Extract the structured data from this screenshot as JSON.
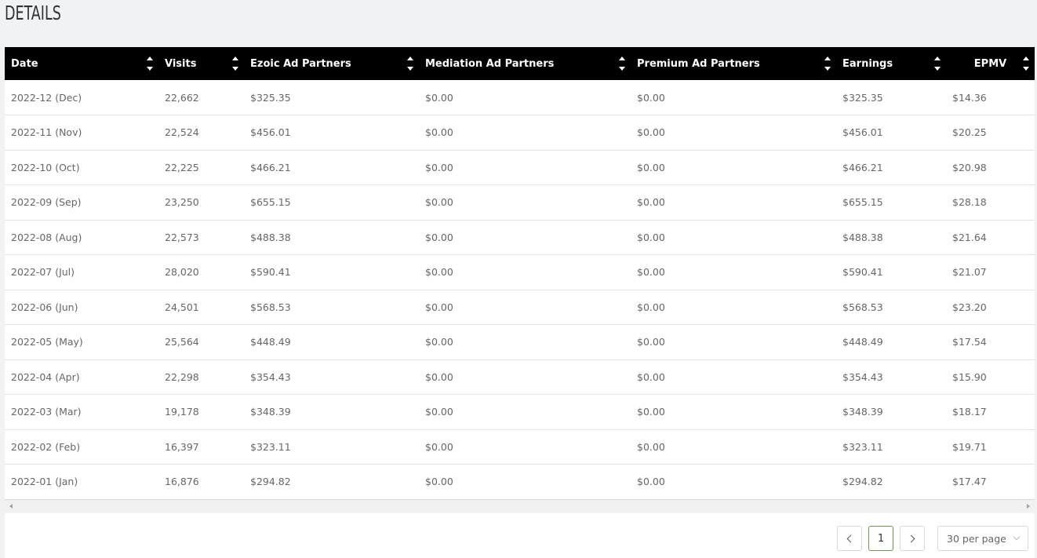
{
  "page": {
    "title": "DETAILS"
  },
  "table": {
    "columns": [
      "Date",
      "Visits",
      "Ezoic Ad Partners",
      "Mediation Ad Partners",
      "Premium Ad Partners",
      "Earnings",
      "EPMV"
    ],
    "rows": [
      [
        "2022-12 (Dec)",
        "22,662",
        "$325.35",
        "$0.00",
        "$0.00",
        "$325.35",
        "$14.36"
      ],
      [
        "2022-11 (Nov)",
        "22,524",
        "$456.01",
        "$0.00",
        "$0.00",
        "$456.01",
        "$20.25"
      ],
      [
        "2022-10 (Oct)",
        "22,225",
        "$466.21",
        "$0.00",
        "$0.00",
        "$466.21",
        "$20.98"
      ],
      [
        "2022-09 (Sep)",
        "23,250",
        "$655.15",
        "$0.00",
        "$0.00",
        "$655.15",
        "$28.18"
      ],
      [
        "2022-08 (Aug)",
        "22,573",
        "$488.38",
        "$0.00",
        "$0.00",
        "$488.38",
        "$21.64"
      ],
      [
        "2022-07 (Jul)",
        "28,020",
        "$590.41",
        "$0.00",
        "$0.00",
        "$590.41",
        "$21.07"
      ],
      [
        "2022-06 (Jun)",
        "24,501",
        "$568.53",
        "$0.00",
        "$0.00",
        "$568.53",
        "$23.20"
      ],
      [
        "2022-05 (May)",
        "25,564",
        "$448.49",
        "$0.00",
        "$0.00",
        "$448.49",
        "$17.54"
      ],
      [
        "2022-04 (Apr)",
        "22,298",
        "$354.43",
        "$0.00",
        "$0.00",
        "$354.43",
        "$15.90"
      ],
      [
        "2022-03 (Mar)",
        "19,178",
        "$348.39",
        "$0.00",
        "$0.00",
        "$348.39",
        "$18.17"
      ],
      [
        "2022-02 (Feb)",
        "16,397",
        "$323.11",
        "$0.00",
        "$0.00",
        "$323.11",
        "$19.71"
      ],
      [
        "2022-01 (Jan)",
        "16,876",
        "$294.82",
        "$0.00",
        "$0.00",
        "$294.82",
        "$17.47"
      ]
    ]
  },
  "pagination": {
    "current_page": "1",
    "per_page": "30 per page",
    "prev_icon": "chevron-left-icon",
    "next_icon": "chevron-right-icon"
  }
}
